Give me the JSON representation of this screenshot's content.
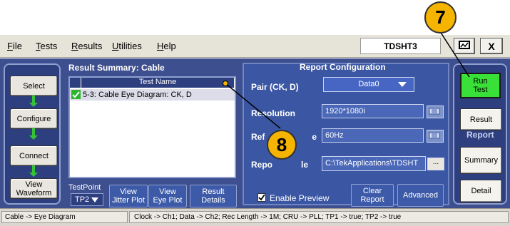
{
  "menu": {
    "items": [
      {
        "first": "F",
        "rest": "ile"
      },
      {
        "first": "T",
        "rest": "ests"
      },
      {
        "first": "R",
        "rest": "esults"
      },
      {
        "first": "U",
        "rest": "tilities"
      },
      {
        "first": "H",
        "rest": "elp"
      }
    ],
    "app_title": "TDSHT3",
    "close_label": "X"
  },
  "nav": {
    "select": "Select",
    "configure": "Configure",
    "connect": "Connect",
    "view_waveform_1": "View",
    "view_waveform_2": "Waveform"
  },
  "result_summary": {
    "title": "Result Summary: Cable",
    "column_header": "Test Name",
    "rows": [
      {
        "name": "5-3: Cable Eye Diagram: CK, D",
        "checked": true
      }
    ]
  },
  "bottom_controls": {
    "testpoint_label": "TestPoint",
    "testpoint_value": "TP2",
    "view_jitter_1": "View",
    "view_jitter_2": "Jitter Plot",
    "view_eye_1": "View",
    "view_eye_2": "Eye Plot",
    "result_details_1": "Result",
    "result_details_2": "Details"
  },
  "report_config": {
    "title": "Report Configuration",
    "pair_label": "Pair (CK, D)",
    "pair_value": "Data0",
    "resolution_label": "Resolution",
    "resolution_value": "1920*1080i",
    "refresh_label_a": "Ref",
    "refresh_label_b": "e",
    "refresh_value": "60Hz",
    "report_label_a": "Repo",
    "report_label_b": "le",
    "report_value": "C:\\TekApplications\\TDSHT",
    "dots": "...",
    "enable_preview": "Enable Preview",
    "clear_report_1": "Clear",
    "clear_report_2": "Report",
    "advanced": "Advanced"
  },
  "right_panel": {
    "run_test_1": "Run",
    "run_test_2": "Test",
    "result": "Result",
    "report_group": "Report",
    "summary": "Summary",
    "detail": "Detail"
  },
  "status": {
    "left": "Cable -> Eye Diagram",
    "right": "Clock -> Ch1; Data -> Ch2; Rec Length -> 1M; CRU -> PLL; TP1 -> true; TP2 -> true"
  },
  "callouts": {
    "seven": "7",
    "eight": "8"
  },
  "colors": {
    "panel_blue": "#3b57a3",
    "run_green": "#38e038",
    "callout_gold": "#f5b400",
    "arrow_green": "#35c235"
  }
}
